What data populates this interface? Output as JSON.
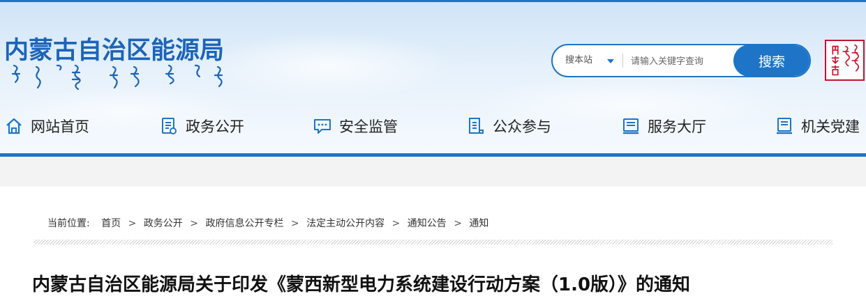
{
  "header": {
    "site_title": "内蒙古自治区能源局",
    "search": {
      "scope_label": "搜本站",
      "placeholder": "请输入关键字查询",
      "button_label": "搜索"
    }
  },
  "nav": {
    "items": [
      {
        "label": "网站首页",
        "icon": "home-icon"
      },
      {
        "label": "政务公开",
        "icon": "document-icon"
      },
      {
        "label": "安全监管",
        "icon": "chat-bubble-icon"
      },
      {
        "label": "公众参与",
        "icon": "clipboard-icon"
      },
      {
        "label": "服务大厅",
        "icon": "service-book-icon"
      },
      {
        "label": "机关党建",
        "icon": "party-book-icon"
      }
    ]
  },
  "breadcrumb": {
    "prefix": "当前位置:",
    "items": [
      "首页",
      "政务公开",
      "政府信息公开专栏",
      "法定主动公开内容",
      "通知公告",
      "通知"
    ],
    "separator": ">"
  },
  "article": {
    "title": "内蒙古自治区能源局关于印发《蒙西新型电力系统建设行动方案（1.0版）》的通知"
  },
  "colors": {
    "brand_blue": "#1e75c7",
    "title_blue": "#1c64b8",
    "seal_red": "#c8102e"
  }
}
